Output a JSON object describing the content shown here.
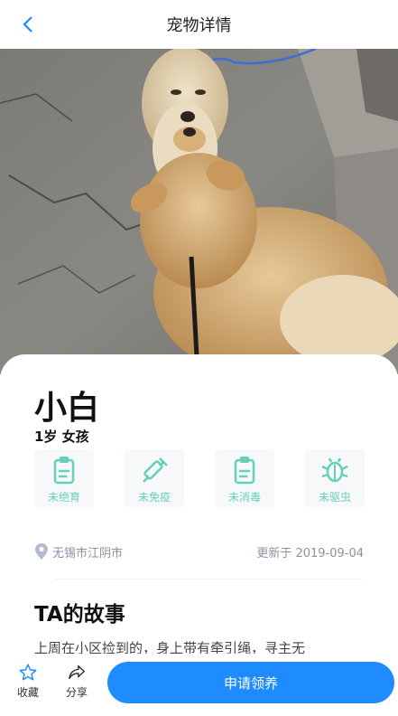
{
  "nav": {
    "title": "宠物详情"
  },
  "pet": {
    "name": "小白",
    "age_gender": "1岁 女孩",
    "statuses": [
      {
        "label": "未绝育",
        "icon": "clipboard-icon"
      },
      {
        "label": "未免疫",
        "icon": "syringe-icon"
      },
      {
        "label": "未消毒",
        "icon": "clipboard-icon"
      },
      {
        "label": "未驱虫",
        "icon": "bug-icon"
      }
    ],
    "location": "无锡市江阴市",
    "updated": "更新于 2019-09-04"
  },
  "story": {
    "title": "TA的故事",
    "text": "上周在小区捡到的，身上带有牵引绳，寻主无"
  },
  "bottom": {
    "favorite_label": "收藏",
    "share_label": "分享",
    "apply_label": "申请领养"
  },
  "colors": {
    "accent": "#1e8bff",
    "status_green": "#66d0b6",
    "muted": "#8a92a0"
  }
}
